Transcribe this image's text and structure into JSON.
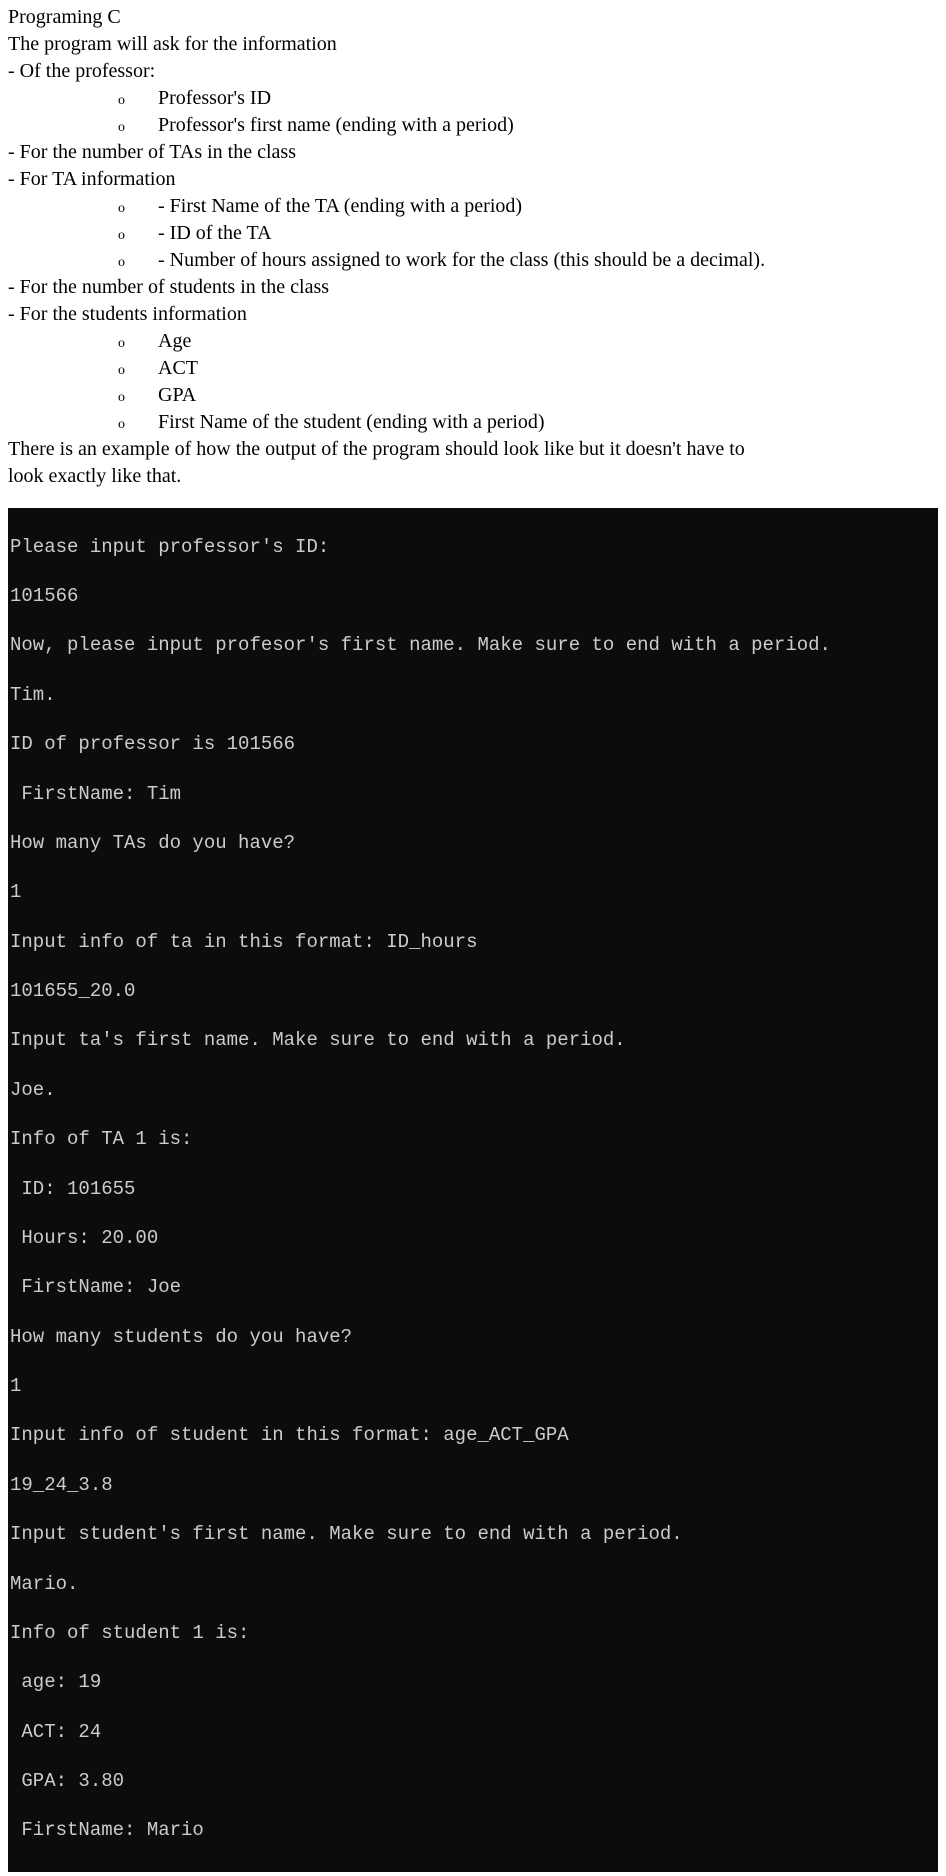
{
  "doc": {
    "title": "Programing C",
    "intro": "The program will ask for the information",
    "prof_header": "- Of the professor:",
    "prof_items": [
      "Professor's ID",
      "Professor's first name (ending with a period)"
    ],
    "ta_count": "- For the number of TAs in the class",
    "ta_header": "- For TA information",
    "ta_items": [
      "- First Name of the TA (ending with a period)",
      "- ID of the TA",
      "- Number of hours assigned to work for the class (this should be a decimal)."
    ],
    "stu_count": "- For the number of students in the class",
    "stu_header": "- For the students information",
    "stu_items": [
      "Age",
      "ACT",
      "GPA",
      "First Name of the student (ending with a period)"
    ],
    "outro1": "There is an example of how the output of the program should look like but it doesn't have to",
    "outro2": "look exactly like that."
  },
  "terminal": {
    "lines": [
      "Please input professor's ID:",
      "101566",
      "Now, please input profesor's first name. Make sure to end with a period.",
      "Tim.",
      "ID of professor is 101566",
      " FirstName: Tim",
      "How many TAs do you have?",
      "1",
      "Input info of ta in this format: ID_hours",
      "101655_20.0",
      "Input ta's first name. Make sure to end with a period.",
      "Joe.",
      "Info of TA 1 is:",
      " ID: 101655",
      " Hours: 20.00",
      " FirstName: Joe",
      "How many students do you have?",
      "1",
      "Input info of student in this format: age_ACT_GPA",
      "19_24_3.8",
      "Input student's first name. Make sure to end with a period.",
      "Mario.",
      "Info of student 1 is:",
      " age: 19",
      " ACT: 24",
      " GPA: 3.80",
      " FirstName: Mario"
    ]
  }
}
